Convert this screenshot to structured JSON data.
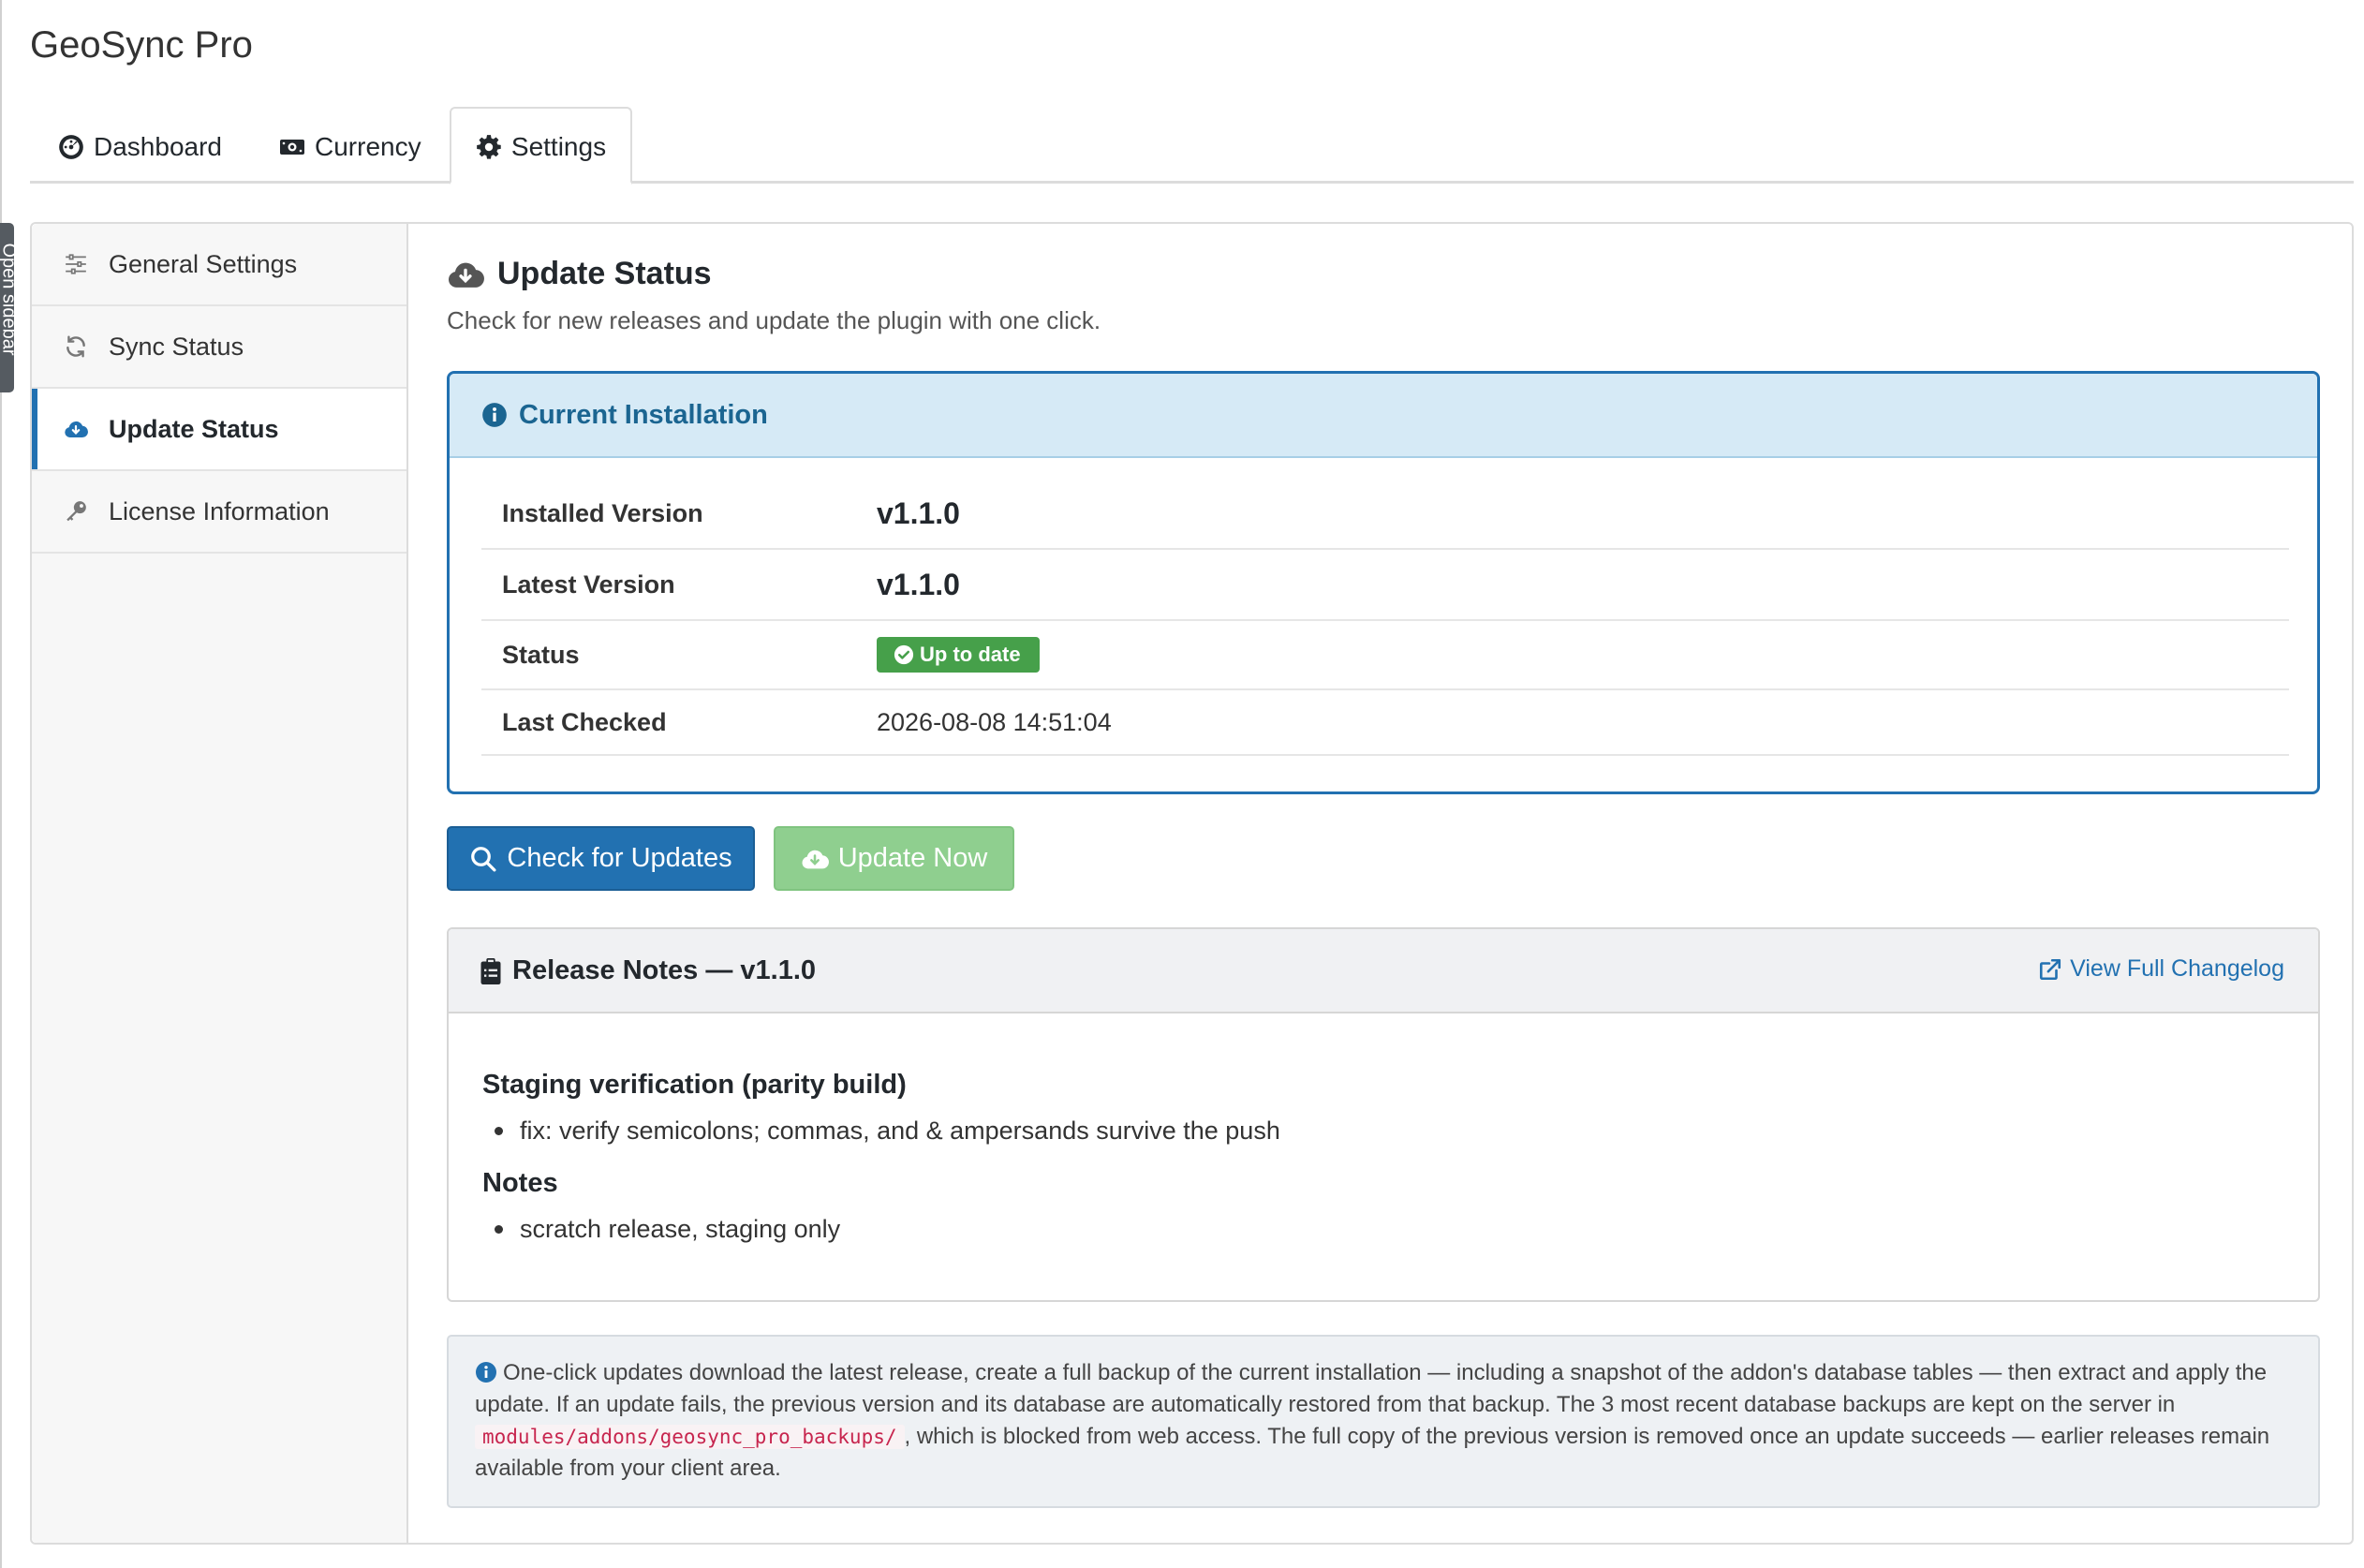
{
  "sidebar_toggle": {
    "label": "Open sidebar"
  },
  "app": {
    "title": "GeoSync Pro"
  },
  "tabs": [
    {
      "label": "Dashboard",
      "icon": "dashboard-icon"
    },
    {
      "label": "Currency",
      "icon": "money-icon"
    },
    {
      "label": "Settings",
      "icon": "gear-icon",
      "active": true
    }
  ],
  "nav": [
    {
      "label": "General Settings",
      "icon": "sliders-icon"
    },
    {
      "label": "Sync Status",
      "icon": "sync-icon"
    },
    {
      "label": "Update Status",
      "icon": "cloud-download-icon",
      "active": true
    },
    {
      "label": "License Information",
      "icon": "key-icon"
    }
  ],
  "section": {
    "title": "Update Status",
    "subtitle": "Check for new releases and update the plugin with one click."
  },
  "installation": {
    "title": "Current Installation",
    "rows": [
      {
        "label": "Installed Version",
        "value": "v1.1.0"
      },
      {
        "label": "Latest Version",
        "value": "v1.1.0"
      },
      {
        "label": "Status",
        "value": "Up to date"
      },
      {
        "label": "Last Checked",
        "value": "2026-08-08 14:51:04"
      }
    ]
  },
  "actions": {
    "check_label": "Check for Updates",
    "update_label": "Update Now"
  },
  "release_notes": {
    "title": "Release Notes — v1.1.0",
    "changelog_link": "View Full Changelog",
    "sections": [
      {
        "heading": "Staging verification (parity build)",
        "items": [
          "fix: verify semicolons; commas, and & ampersands survive the push"
        ]
      },
      {
        "heading": "Notes",
        "items": [
          "scratch release, staging only"
        ]
      }
    ]
  },
  "footnote": {
    "text_before": "One-click updates download the latest release, create a full backup of the current installation — including a snapshot of the addon's database tables — then extract and apply the update. If an update fails, the previous version and its database are automatically restored from that backup. The 3 most recent database backups are kept on the server in",
    "path": "modules/addons/geosync_pro_backups/",
    "text_after": ", which is blocked from web access. The full copy of the previous version is removed once an update succeeds — earlier releases remain available from your client area."
  },
  "colors": {
    "primary": "#2271b1",
    "success": "#46a04a",
    "update_button": "#8fcf8f",
    "info_header_bg": "#d6eaf6",
    "info_header_text": "#1b6591"
  }
}
